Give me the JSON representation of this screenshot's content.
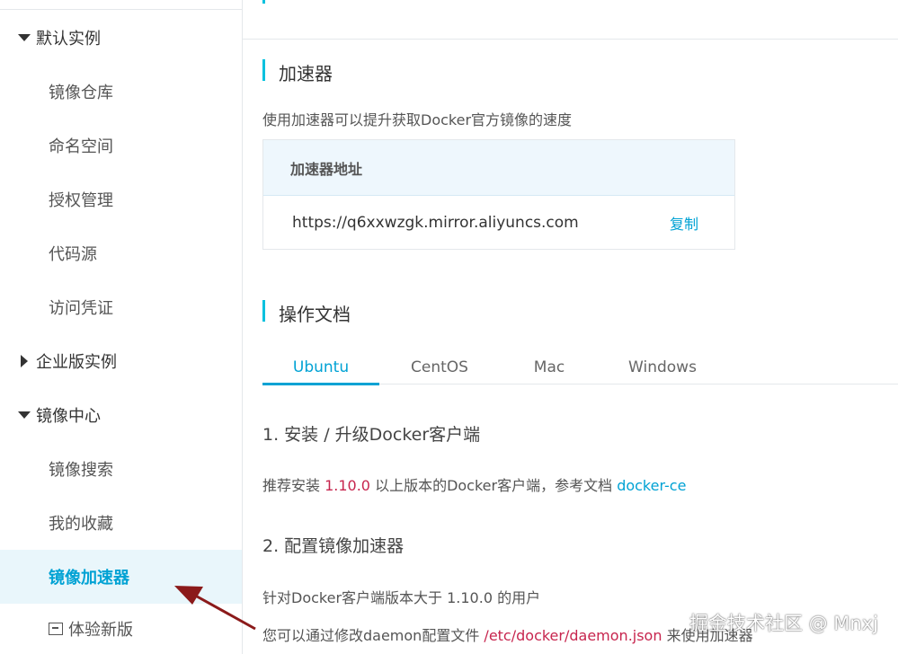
{
  "sidebar": {
    "group_default": "默认实例",
    "items_default": [
      "镜像仓库",
      "命名空间",
      "授权管理",
      "代码源",
      "访问凭证"
    ],
    "group_enterprise": "企业版实例",
    "group_mirror": "镜像中心",
    "items_mirror": [
      "镜像搜索",
      "我的收藏",
      "镜像加速器"
    ],
    "try_new": "体验新版",
    "active_item": "镜像加速器"
  },
  "accelerator": {
    "title": "加速器",
    "desc": "使用加速器可以提升获取Docker官方镜像的速度",
    "table_header": "加速器地址",
    "address": "https://q6xxwzgk.mirror.aliyuncs.com",
    "copy_label": "复制"
  },
  "docs": {
    "title": "操作文档",
    "tabs": [
      "Ubuntu",
      "CentOS",
      "Mac",
      "Windows"
    ],
    "active_tab": "Ubuntu",
    "step1_title": "1. 安装 / 升级Docker客户端",
    "step1_text_a": "推荐安装 ",
    "step1_version": "1.10.0",
    "step1_text_b": " 以上版本的Docker客户端，参考文档 ",
    "step1_link": "docker-ce",
    "step2_title": "2. 配置镜像加速器",
    "step2_line1": "针对Docker客户端版本大于 1.10.0 的用户",
    "step2_line2_a": "您可以通过修改daemon配置文件 ",
    "step2_path": "/etc/docker/daemon.json",
    "step2_line2_b": " 来使用加速器"
  },
  "watermark": "掘金技术社区 @ Mnxj",
  "colors": {
    "accent": "#00a2d4",
    "accent_bar": "#00c1de",
    "code_red": "#c7254e",
    "active_bg": "#e9f6fb",
    "arrow": "#8b1a1a"
  }
}
